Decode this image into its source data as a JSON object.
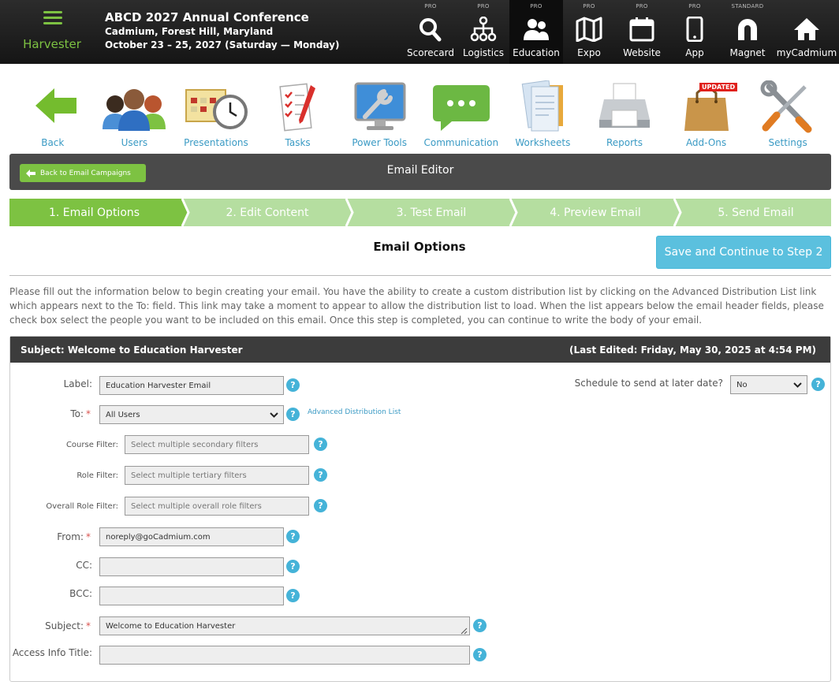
{
  "brand": {
    "name": "Harvester"
  },
  "event": {
    "title": "ABCD 2027 Annual Conference",
    "location": "Cadmium, Forest Hill, Maryland",
    "dates": "October 23 – 25, 2027 (Saturday — Monday)"
  },
  "modules": [
    {
      "tier": "PRO",
      "label": "Scorecard",
      "icon": "search-icon"
    },
    {
      "tier": "PRO",
      "label": "Logistics",
      "icon": "hierarchy-icon"
    },
    {
      "tier": "PRO",
      "label": "Education",
      "icon": "people-icon",
      "active": true
    },
    {
      "tier": "PRO",
      "label": "Expo",
      "icon": "map-icon"
    },
    {
      "tier": "PRO",
      "label": "Website",
      "icon": "calendar-icon"
    },
    {
      "tier": "PRO",
      "label": "App",
      "icon": "phone-icon"
    },
    {
      "tier": "STANDARD",
      "label": "Magnet",
      "icon": "magnet-icon"
    },
    {
      "tier": "",
      "label": "myCadmium",
      "icon": "home-icon"
    }
  ],
  "tools": [
    {
      "label": "Back",
      "icon": "back-arrow-icon"
    },
    {
      "label": "Users",
      "icon": "users-icon"
    },
    {
      "label": "Presentations",
      "icon": "presentations-icon"
    },
    {
      "label": "Tasks",
      "icon": "tasks-icon"
    },
    {
      "label": "Power Tools",
      "icon": "power-tools-icon"
    },
    {
      "label": "Communication",
      "icon": "communication-icon"
    },
    {
      "label": "Worksheets",
      "icon": "worksheets-icon"
    },
    {
      "label": "Reports",
      "icon": "reports-icon"
    },
    {
      "label": "Add-Ons",
      "icon": "add-ons-icon",
      "badge": "UPDATED"
    },
    {
      "label": "Settings",
      "icon": "settings-icon"
    }
  ],
  "editor": {
    "back_label": "Back to Email Campaigns",
    "title": "Email Editor"
  },
  "steps": [
    "1. Email Options",
    "2. Edit Content",
    "3. Test Email",
    "4. Preview Email",
    "5. Send Email"
  ],
  "options": {
    "title": "Email Options",
    "save_label": "Save and Continue to Step 2",
    "intro": "Please fill out the information below to begin creating your email. You have the ability to create a custom distribution list by clicking on the Advanced Distribution List link which appears next to the To: field. This link may take a moment to appear to allow the distribution list to load. When the list appears below the email header fields, please check box select the people you want to be included on this email. Once this step is completed, you can continue to write the body of your email."
  },
  "panel": {
    "subject_header": "Subject: Welcome to Education Harvester",
    "last_edited": "(Last Edited: Friday, May 30, 2025 at 4:54 PM)"
  },
  "form": {
    "label_label": "Label:",
    "label_value": "Education Harvester Email",
    "to_label": "To:",
    "to_value": "All Users",
    "advanced_link": "Advanced Distribution List",
    "course_filter_label": "Course Filter:",
    "course_filter_ph": "Select multiple secondary filters",
    "role_filter_label": "Role Filter:",
    "role_filter_ph": "Select multiple tertiary filters",
    "overall_role_label": "Overall Role Filter:",
    "overall_role_ph": "Select multiple overall role filters",
    "from_label": "From:",
    "from_value": "noreply@goCadmium.com",
    "cc_label": "CC:",
    "cc_value": "",
    "bcc_label": "BCC:",
    "bcc_value": "",
    "subject_label": "Subject:",
    "subject_value": "Welcome to Education Harvester",
    "access_label": "Access Info Title:",
    "access_value": "",
    "schedule_label": "Schedule to send at later date?",
    "schedule_value": "No",
    "help_glyph": "?",
    "required_glyph": "*"
  },
  "colors": {
    "accent_green": "#7dc242",
    "step_inactive": "#b5dea0",
    "save_blue": "#5bc0de",
    "help_blue": "#45b3d8"
  }
}
